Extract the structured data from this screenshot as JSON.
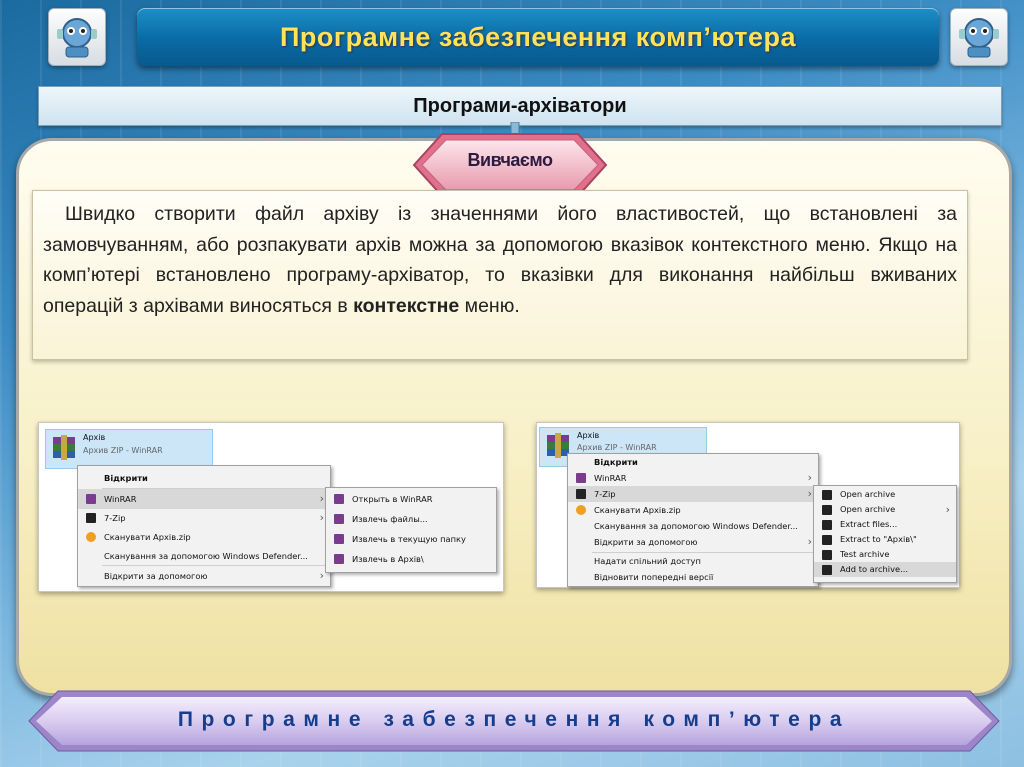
{
  "header": {
    "title": "Програмне забезпечення комп’ютера"
  },
  "subtitle": "Програми-архіватори",
  "badge": "Вивчаємо",
  "paragraph": {
    "text_before": "Швидко створити файл архіву із значеннями його властивостей, що встановлені за замовчуванням, або розпакувати архів можна за допомогою вказівок контекстного меню. Якщо на комп’ютері встановлено програму-архіватор, то вказівки для виконання найбільш вживаних операцій з архівами виносяться в ",
    "bold": "контекстне",
    "text_after": " меню."
  },
  "left_shot": {
    "file_name": "Архів",
    "file_type": "Архив ZIP - WinRAR",
    "menu": [
      {
        "label": "Відкрити",
        "bold": true
      },
      {
        "label": "WinRAR",
        "icon": "winrar-icon",
        "submenu": true,
        "highlight": true
      },
      {
        "label": "7-Zip",
        "icon": "7zip-icon",
        "submenu": true
      },
      {
        "label": "Сканувати Архів.zip",
        "icon": "scan-icon"
      },
      {
        "label": "Сканування за допомогою Windows Defender...",
        "icon": ""
      },
      {
        "label": "Відкрити за допомогою",
        "submenu": true
      }
    ],
    "submenu": [
      "Открыть в WinRAR",
      "Извлечь файлы...",
      "Извлечь в текущую папку",
      "Извлечь в Архів\\"
    ]
  },
  "right_shot": {
    "file_name": "Архів",
    "file_type": "Архив ZIP - WinRAR",
    "menu": [
      {
        "label": "Відкрити",
        "bold": true
      },
      {
        "label": "WinRAR",
        "icon": "winrar-icon",
        "submenu": true
      },
      {
        "label": "7-Zip",
        "icon": "7zip-icon",
        "submenu": true,
        "highlight": true
      },
      {
        "label": "Сканувати Архів.zip",
        "icon": "scan-icon"
      },
      {
        "label": "Сканування за допомогою Windows Defender...",
        "icon": ""
      },
      {
        "label": "Відкрити за допомогою",
        "submenu": true
      },
      {
        "label": "Надати спільний доступ"
      },
      {
        "label": "Відновити попередні версії"
      }
    ],
    "submenu": [
      "Open archive",
      "Open archive",
      "Extract files...",
      "Extract to \"Архів\\\"",
      "Test archive",
      "Add to archive..."
    ]
  },
  "footer": {
    "text": "Програмне забезпечення комп’ютера"
  },
  "colors": {
    "title": "#ffe15a",
    "footer": "#173e8c",
    "accent": "#0a6aa4"
  }
}
